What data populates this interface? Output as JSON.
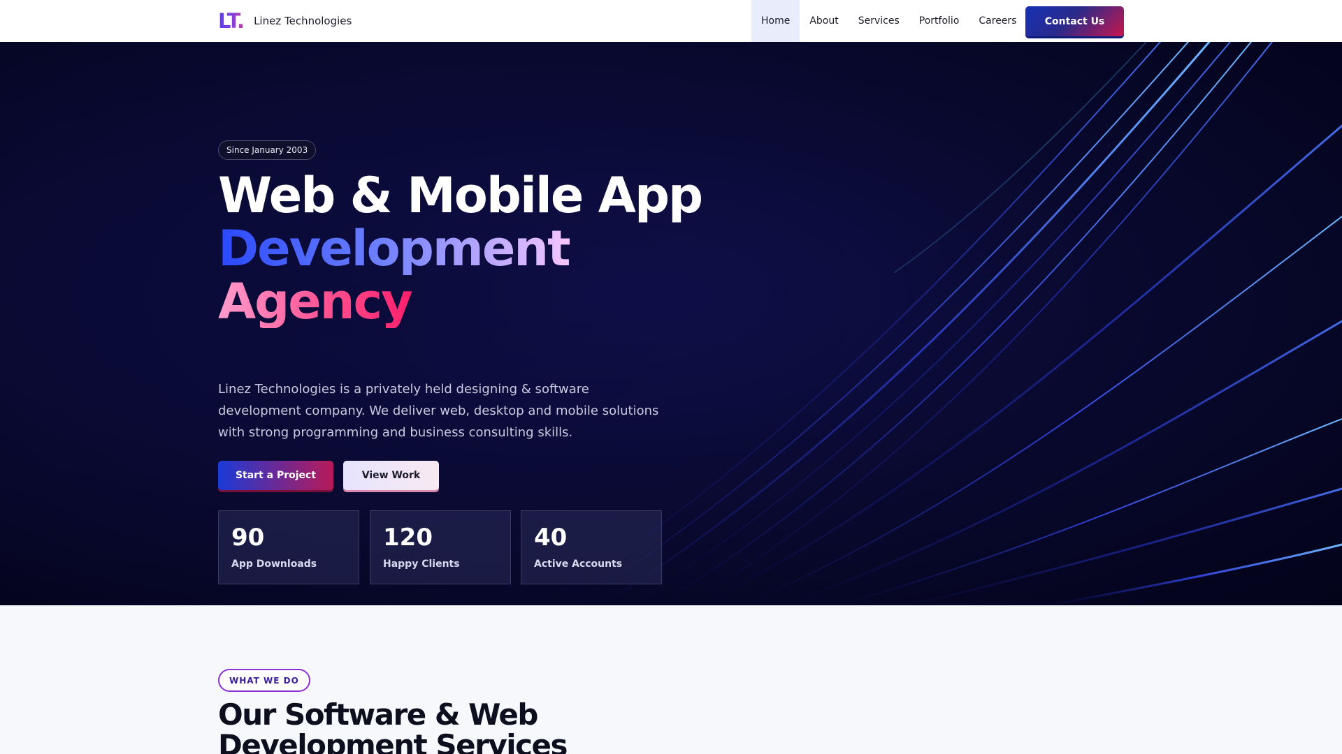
{
  "header": {
    "logo_text": "LT.",
    "brand_name": "Linez Technologies",
    "nav": [
      {
        "label": "Home",
        "active": true
      },
      {
        "label": "About"
      },
      {
        "label": "Services"
      },
      {
        "label": "Portfolio"
      },
      {
        "label": "Careers"
      }
    ],
    "contact_label": "Contact Us"
  },
  "hero": {
    "badge": "Since January 2003",
    "title_line1": "Web & Mobile App",
    "title_line2": "Development",
    "title_line3": "Agency",
    "description": "Linez Technologies is a privately held designing & software development company. We deliver web, desktop and mobile solutions with strong programming and business consulting skills.",
    "primary_cta": "Start a Project",
    "secondary_cta": "View Work",
    "stats": [
      {
        "value": "90",
        "label": "App Downloads"
      },
      {
        "value": "120",
        "label": "Happy Clients"
      },
      {
        "value": "40",
        "label": "Active Accounts"
      }
    ]
  },
  "services": {
    "eyebrow": "WHAT WE DO",
    "title": "Our Software & Web Development Services"
  },
  "colors": {
    "accent_blue": "#1b3ad6",
    "accent_pink": "#ff1f6b",
    "hero_bg": "#03031a"
  }
}
